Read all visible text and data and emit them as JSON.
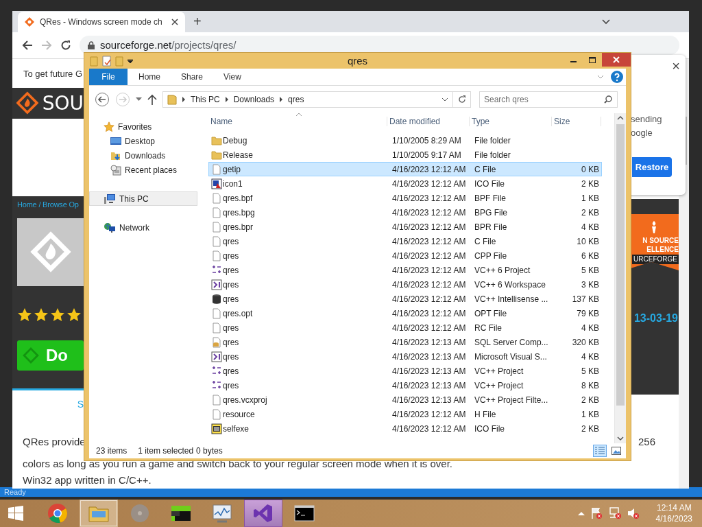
{
  "browser": {
    "tab_title": "QRes - Windows screen mode ch",
    "new_tab": "+",
    "url_host": "sourceforge.net",
    "url_path": "/projects/qres/",
    "page": {
      "notice": "To get future G",
      "logo_text": "SOU",
      "breadcrumb": "Home / Browse Op",
      "stars": 4,
      "download_label": "Do",
      "tab_link": "S",
      "badge_lines": [
        "N SOURCE",
        "ELLENCE",
        "URCEFORGE"
      ],
      "date": "13-03-19",
      "description_start": "QRes provide",
      "description_end": "256",
      "description_lines": [
        "colors as long as you run a game and switch back to your regular screen mode when it is over.",
        "Win32 app written in C/C++."
      ]
    },
    "popup": {
      "lines": [
        "sending",
        "oogle"
      ],
      "button": "Restore",
      "close": "×"
    }
  },
  "explorer": {
    "title": "qres",
    "file_tab": "File",
    "ribbon_tabs": [
      "Home",
      "Share",
      "View"
    ],
    "path": [
      "This PC",
      "Downloads",
      "qres"
    ],
    "search_placeholder": "Search qres",
    "nav": [
      {
        "label": "Favorites",
        "kind": "favorites",
        "selected": false,
        "children": [
          {
            "label": "Desktop",
            "kind": "desktop",
            "selected": false
          },
          {
            "label": "Downloads",
            "kind": "downloads",
            "selected": false
          },
          {
            "label": "Recent places",
            "kind": "recent",
            "selected": false
          }
        ]
      },
      {
        "label": "This PC",
        "kind": "pc",
        "selected": true
      },
      {
        "label": "Network",
        "kind": "network",
        "selected": false
      }
    ],
    "columns": [
      "Name",
      "Date modified",
      "Type",
      "Size"
    ],
    "files": [
      {
        "name": "Debug",
        "date": "1/10/2005 8:29 AM",
        "type": "File folder",
        "kind": "folder",
        "selected": false
      },
      {
        "name": "Release",
        "date": "1/10/2005 9:17 AM",
        "type": "File folder",
        "kind": "folder",
        "selected": false
      },
      {
        "name": "getip",
        "date": "4/16/2023 12:12 AM",
        "type": "C File",
        "size": "0 KB",
        "kind": "document",
        "selected": true
      },
      {
        "name": "icon1",
        "date": "4/16/2023 12:12 AM",
        "type": "ICO File",
        "size": "2 KB",
        "kind": "image",
        "selected": false
      },
      {
        "name": "qres.bpf",
        "date": "4/16/2023 12:12 AM",
        "type": "BPF File",
        "size": "1 KB",
        "kind": "document",
        "selected": false
      },
      {
        "name": "qres.bpg",
        "date": "4/16/2023 12:12 AM",
        "type": "BPG File",
        "size": "2 KB",
        "kind": "document",
        "selected": false
      },
      {
        "name": "qres.bpr",
        "date": "4/16/2023 12:12 AM",
        "type": "BPR File",
        "size": "4 KB",
        "kind": "document",
        "selected": false
      },
      {
        "name": "qres",
        "date": "4/16/2023 12:12 AM",
        "type": "C File",
        "size": "10 KB",
        "kind": "document",
        "selected": false
      },
      {
        "name": "qres",
        "date": "4/16/2023 12:12 AM",
        "type": "CPP File",
        "size": "6 KB",
        "kind": "document",
        "selected": false
      },
      {
        "name": "qres",
        "date": "4/16/2023 12:12 AM",
        "type": "VC++ 6 Project",
        "size": "5 KB",
        "kind": "project",
        "selected": false
      },
      {
        "name": "qres",
        "date": "4/16/2023 12:12 AM",
        "type": "VC++ 6 Workspace",
        "size": "3 KB",
        "kind": "workspace",
        "selected": false
      },
      {
        "name": "qres",
        "date": "4/16/2023 12:12 AM",
        "type": "VC++ Intellisense ...",
        "size": "137 KB",
        "kind": "database",
        "selected": false
      },
      {
        "name": "qres.opt",
        "date": "4/16/2023 12:12 AM",
        "type": "OPT File",
        "size": "79 KB",
        "kind": "document",
        "selected": false
      },
      {
        "name": "qres",
        "date": "4/16/2023 12:12 AM",
        "type": "RC File",
        "size": "4 KB",
        "kind": "document",
        "selected": false
      },
      {
        "name": "qres",
        "date": "4/16/2023 12:13 AM",
        "type": "SQL Server Comp...",
        "size": "320 KB",
        "kind": "sqldb",
        "selected": false
      },
      {
        "name": "qres",
        "date": "4/16/2023 12:13 AM",
        "type": "Microsoft Visual S...",
        "size": "4 KB",
        "kind": "workspace",
        "selected": false
      },
      {
        "name": "qres",
        "date": "4/16/2023 12:13 AM",
        "type": "VC++ Project",
        "size": "5 KB",
        "kind": "project",
        "selected": false
      },
      {
        "name": "qres",
        "date": "4/16/2023 12:13 AM",
        "type": "VC++ Project",
        "size": "8 KB",
        "kind": "project",
        "selected": false
      },
      {
        "name": "qres.vcxproj",
        "date": "4/16/2023 12:13 AM",
        "type": "VC++ Project Filte...",
        "size": "2 KB",
        "kind": "document",
        "selected": false
      },
      {
        "name": "resource",
        "date": "4/16/2023 12:12 AM",
        "type": "H File",
        "size": "1 KB",
        "kind": "document",
        "selected": false
      },
      {
        "name": "selfexe",
        "date": "4/16/2023 12:12 AM",
        "type": "ICO File",
        "size": "2 KB",
        "kind": "program",
        "selected": false
      }
    ],
    "status": {
      "count": "23 items",
      "selection": "1 item selected",
      "size": "0 bytes"
    },
    "details_view": true
  },
  "status_strip": {
    "text": "Ready"
  },
  "taskbar": {
    "apps": [
      {
        "kind": "chrome",
        "selected": false,
        "hovered": false
      },
      {
        "kind": "explorer",
        "selected": true,
        "hovered": false
      },
      {
        "kind": "disc",
        "selected": false,
        "hovered": false
      },
      {
        "kind": "green",
        "selected": false,
        "hovered": false
      },
      {
        "kind": "monitor",
        "selected": false,
        "hovered": false
      },
      {
        "kind": "studio",
        "selected": false,
        "hovered": true
      },
      {
        "kind": "console",
        "selected": false,
        "hovered": false
      }
    ],
    "time": "12:14 AM",
    "date": "4/16/2023"
  }
}
